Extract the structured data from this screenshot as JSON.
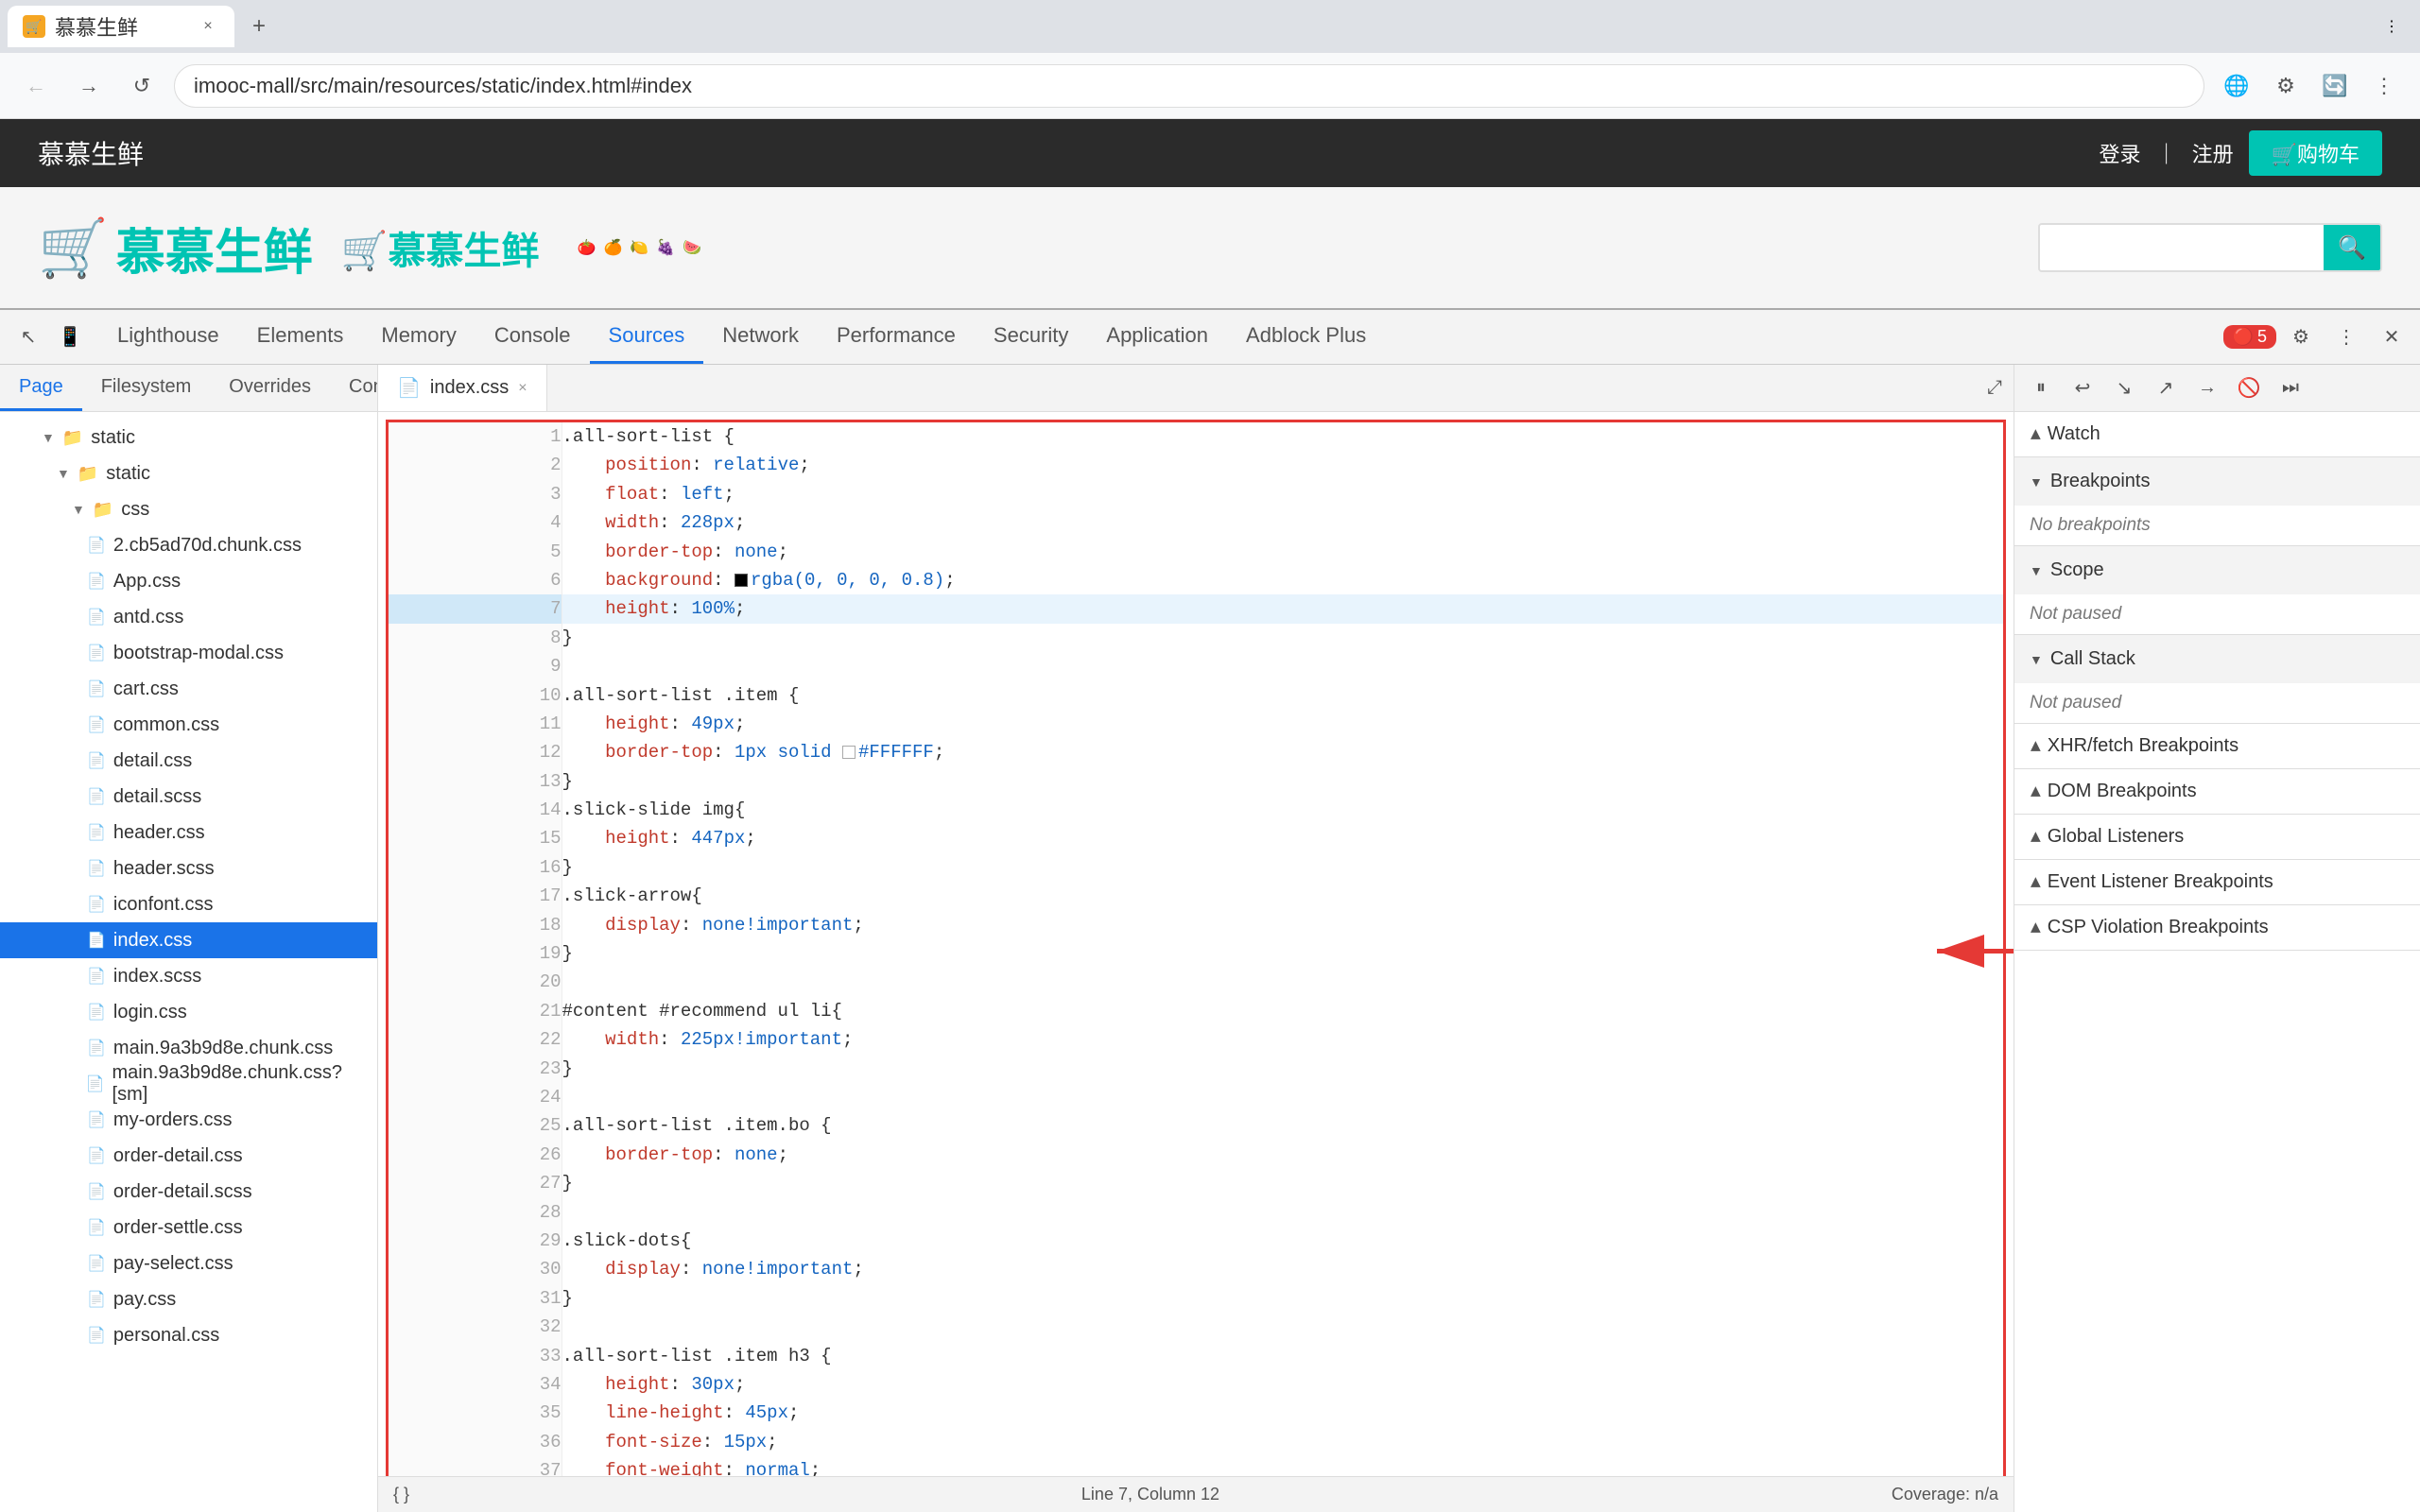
{
  "browser": {
    "tab": {
      "favicon": "🛒",
      "title": "慕慕生鲜",
      "close_icon": "×"
    },
    "new_tab_icon": "+",
    "window_menu_icon": "⋮",
    "nav": {
      "back_icon": "←",
      "forward_icon": "→",
      "reload_icon": "↺",
      "address": "imooc-mall/src/main/resources/static/index.html#index",
      "address_prefix": "",
      "ext_icon1": "🌐",
      "ext_icon2": "⚙",
      "ext_icon3": "🔄",
      "menu_icon": "⋮"
    }
  },
  "page": {
    "header": {
      "logo": "慕慕生鲜",
      "login": "登录",
      "separator": "｜",
      "register": "注册",
      "cart": "🛒购物车"
    },
    "body": {
      "logo_char": "🛒",
      "logo_text": "慕慕生鲜",
      "logo_text2": "🛒慕慕生鲜",
      "fruits": [
        "🍅",
        "🍊",
        "🍋",
        "🍇",
        "🍉"
      ],
      "search_placeholder": ""
    }
  },
  "devtools": {
    "toolbar_icons": {
      "cursor": "↖",
      "device": "📱",
      "menu": "⋮"
    },
    "tabs": [
      {
        "label": "Lighthouse",
        "active": false
      },
      {
        "label": "Elements",
        "active": false
      },
      {
        "label": "Memory",
        "active": false
      },
      {
        "label": "Console",
        "active": false
      },
      {
        "label": "Sources",
        "active": true
      },
      {
        "label": "Network",
        "active": false
      },
      {
        "label": "Performance",
        "active": false
      },
      {
        "label": "Security",
        "active": false
      },
      {
        "label": "Application",
        "active": false
      },
      {
        "label": "Adblock Plus",
        "active": false
      }
    ],
    "error_count": "5",
    "settings_icon": "⚙",
    "more_icon": "⋮",
    "close_icon": "×"
  },
  "sources": {
    "subtabs": [
      "Page",
      "Filesystem",
      "Overrides",
      "Content scripts",
      "»"
    ],
    "more_btn": "⋮",
    "file_tree": {
      "items": [
        {
          "label": "static",
          "type": "folder",
          "indent": 1,
          "open": true
        },
        {
          "label": "static",
          "type": "folder",
          "indent": 2,
          "open": true
        },
        {
          "label": "css",
          "type": "folder",
          "indent": 3,
          "open": true
        },
        {
          "label": "2.cb5ad70d.chunk.css",
          "type": "file",
          "indent": 4
        },
        {
          "label": "App.css",
          "type": "file",
          "indent": 4
        },
        {
          "label": "antd.css",
          "type": "file",
          "indent": 4
        },
        {
          "label": "bootstrap-modal.css",
          "type": "file",
          "indent": 4
        },
        {
          "label": "cart.css",
          "type": "file",
          "indent": 4
        },
        {
          "label": "common.css",
          "type": "file",
          "indent": 4
        },
        {
          "label": "detail.css",
          "type": "file",
          "indent": 4
        },
        {
          "label": "detail.scss",
          "type": "file",
          "indent": 4
        },
        {
          "label": "header.css",
          "type": "file",
          "indent": 4
        },
        {
          "label": "header.scss",
          "type": "file",
          "indent": 4
        },
        {
          "label": "iconfont.css",
          "type": "file",
          "indent": 4
        },
        {
          "label": "index.css",
          "type": "file",
          "indent": 4,
          "selected": true
        },
        {
          "label": "index.scss",
          "type": "file",
          "indent": 4
        },
        {
          "label": "login.css",
          "type": "file",
          "indent": 4
        },
        {
          "label": "main.9a3b9d8e.chunk.css",
          "type": "file",
          "indent": 4
        },
        {
          "label": "main.9a3b9d8e.chunk.css? [sm]",
          "type": "file",
          "indent": 4
        },
        {
          "label": "my-orders.css",
          "type": "file",
          "indent": 4
        },
        {
          "label": "order-detail.css",
          "type": "file",
          "indent": 4
        },
        {
          "label": "order-detail.scss",
          "type": "file",
          "indent": 4
        },
        {
          "label": "order-settle.css",
          "type": "file",
          "indent": 4
        },
        {
          "label": "pay-select.css",
          "type": "file",
          "indent": 4
        },
        {
          "label": "pay.css",
          "type": "file",
          "indent": 4
        },
        {
          "label": "personal.css",
          "type": "file",
          "indent": 4
        }
      ]
    },
    "editor": {
      "tab_name": "index.css",
      "tab_close": "×",
      "lines": [
        {
          "n": 1,
          "code": ".all-sort-list {",
          "type": "selector"
        },
        {
          "n": 2,
          "code": "    position: relative;",
          "type": "prop-val",
          "prop": "position",
          "val": "relative"
        },
        {
          "n": 3,
          "code": "    float: left;",
          "type": "prop-val",
          "prop": "float",
          "val": "left"
        },
        {
          "n": 4,
          "code": "    width: 228px;",
          "type": "prop-val",
          "prop": "width",
          "val": "228px"
        },
        {
          "n": 5,
          "code": "    border-top: none;",
          "type": "prop-val",
          "prop": "border-top",
          "val": "none"
        },
        {
          "n": 6,
          "code": "    background: ■rgba(0, 0, 0, 0.8);",
          "type": "prop-val-bg",
          "prop": "background",
          "val": "rgba(0, 0, 0, 0.8)"
        },
        {
          "n": 7,
          "code": "    height: 100%;",
          "type": "prop-val",
          "prop": "height",
          "val": "100%"
        },
        {
          "n": 8,
          "code": "}",
          "type": "brace"
        },
        {
          "n": 9,
          "code": "",
          "type": "empty"
        },
        {
          "n": 10,
          "code": ".all-sort-list .item {",
          "type": "selector"
        },
        {
          "n": 11,
          "code": "    height: 49px;",
          "type": "prop-val",
          "prop": "height",
          "val": "49px"
        },
        {
          "n": 12,
          "code": "    border-top: 1px solid □#FFFFFF;",
          "type": "prop-val-border",
          "prop": "border-top",
          "val": "1px solid □#FFFFFF"
        },
        {
          "n": 13,
          "code": "}",
          "type": "brace"
        },
        {
          "n": 14,
          "code": ".slick-slide img{",
          "type": "selector"
        },
        {
          "n": 15,
          "code": "    height: 447px;",
          "type": "prop-val",
          "prop": "height",
          "val": "447px"
        },
        {
          "n": 16,
          "code": "}",
          "type": "brace"
        },
        {
          "n": 17,
          "code": ".slick-arrow{",
          "type": "selector"
        },
        {
          "n": 18,
          "code": "    display: none!important;",
          "type": "prop-val",
          "prop": "display",
          "val": "none!important"
        },
        {
          "n": 19,
          "code": "}",
          "type": "brace"
        },
        {
          "n": 20,
          "code": "",
          "type": "empty"
        },
        {
          "n": 21,
          "code": "#content #recommend ul li{",
          "type": "selector"
        },
        {
          "n": 22,
          "code": "    width: 225px!important;",
          "type": "prop-val",
          "prop": "width",
          "val": "225px!important"
        },
        {
          "n": 23,
          "code": "}",
          "type": "brace"
        },
        {
          "n": 24,
          "code": "",
          "type": "empty"
        },
        {
          "n": 25,
          "code": ".all-sort-list .item.bo {",
          "type": "selector"
        },
        {
          "n": 26,
          "code": "    border-top: none;",
          "type": "prop-val",
          "prop": "border-top",
          "val": "none"
        },
        {
          "n": 27,
          "code": "}",
          "type": "brace"
        },
        {
          "n": 28,
          "code": "",
          "type": "empty"
        },
        {
          "n": 29,
          "code": ".slick-dots{",
          "type": "selector"
        },
        {
          "n": 30,
          "code": "    display: none!important;",
          "type": "prop-val",
          "prop": "display",
          "val": "none!important"
        },
        {
          "n": 31,
          "code": "}",
          "type": "brace"
        },
        {
          "n": 32,
          "code": "",
          "type": "empty"
        },
        {
          "n": 33,
          "code": ".all-sort-list .item h3 {",
          "type": "selector"
        },
        {
          "n": 34,
          "code": "    height: 30px;",
          "type": "prop-val",
          "prop": "height",
          "val": "30px"
        },
        {
          "n": 35,
          "code": "    line-height: 45px;",
          "type": "prop-val",
          "prop": "line-height",
          "val": "45px"
        },
        {
          "n": 36,
          "code": "    font-size: 15px;",
          "type": "prop-val",
          "prop": "font-size",
          "val": "15px"
        },
        {
          "n": 37,
          "code": "    font-weight: normal;",
          "type": "prop-val",
          "prop": "font-weight",
          "val": "normal"
        }
      ],
      "status": {
        "left": "{ }",
        "position": "Line 7, Column 12",
        "right": "Coverage: n/a"
      }
    }
  },
  "right_panel": {
    "buttons": [
      "⏸",
      "⬆",
      "⬇",
      "⬆⬆",
      "➡",
      "🔧",
      "⏭"
    ],
    "sections": [
      {
        "label": "Watch",
        "collapsed": true,
        "content": null
      },
      {
        "label": "Breakpoints",
        "collapsed": false,
        "content": "No breakpoints"
      },
      {
        "label": "Scope",
        "collapsed": false,
        "content": "Not paused"
      },
      {
        "label": "Call Stack",
        "collapsed": false,
        "content": "Not paused"
      },
      {
        "label": "XHR/fetch Breakpoints",
        "collapsed": true,
        "content": null
      },
      {
        "label": "DOM Breakpoints",
        "collapsed": true,
        "content": null
      },
      {
        "label": "Global Listeners",
        "collapsed": true,
        "content": null
      },
      {
        "label": "Event Listener Breakpoints",
        "collapsed": true,
        "content": null
      },
      {
        "label": "CSP Violation Breakpoints",
        "collapsed": true,
        "content": null
      }
    ]
  }
}
